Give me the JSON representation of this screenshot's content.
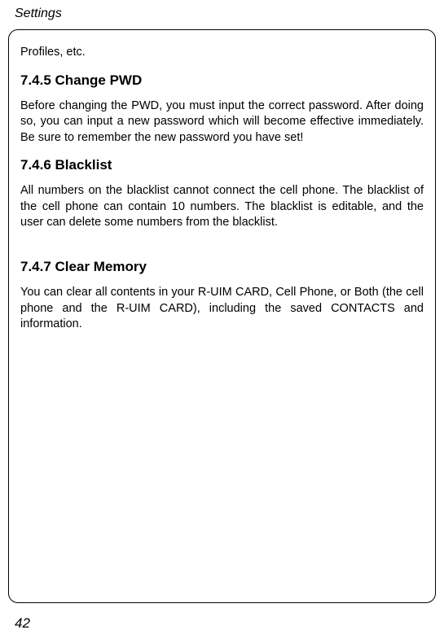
{
  "header": {
    "title": "Settings"
  },
  "content": {
    "intro_fragment": "Profiles, etc.",
    "sections": [
      {
        "heading": "7.4.5 Change PWD",
        "body": "Before changing the PWD, you must input the correct password. After doing so, you can input a new password which will become effective immediately. Be sure to remember the new password you have set!"
      },
      {
        "heading": "7.4.6 Blacklist",
        "body": "All numbers on the blacklist cannot connect the cell phone. The blacklist of the cell phone can contain 10 numbers. The blacklist is editable, and the user can delete some numbers from the blacklist."
      },
      {
        "heading": "7.4.7 Clear Memory",
        "body": "You can clear all contents in your R-UIM CARD, Cell Phone, or Both (the cell phone and the R-UIM CARD), including the saved CONTACTS and information."
      }
    ]
  },
  "page_number": "42"
}
